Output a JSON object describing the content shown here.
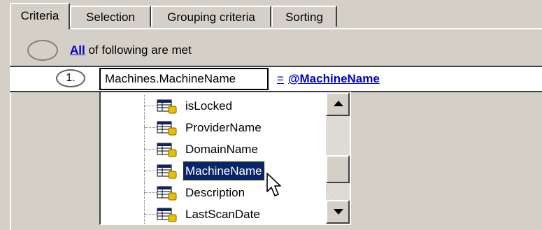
{
  "tabs": [
    {
      "label": "Criteria",
      "active": true
    },
    {
      "label": "Selection",
      "active": false
    },
    {
      "label": "Grouping criteria",
      "active": false
    },
    {
      "label": "Sorting",
      "active": false
    }
  ],
  "group_condition": {
    "quantifier": "All",
    "text": " of following are met"
  },
  "condition": {
    "number": "1.",
    "field": "Machines.MachineName",
    "operator": "=",
    "value": "@MachineName"
  },
  "field_list": {
    "items": [
      {
        "label": "isLocked",
        "icon": "table-field-icon",
        "selected": false
      },
      {
        "label": "ProviderName",
        "icon": "table-field-icon",
        "selected": false
      },
      {
        "label": "DomainName",
        "icon": "table-field-icon",
        "selected": false
      },
      {
        "label": "MachineName",
        "icon": "table-field-icon",
        "selected": true
      },
      {
        "label": "Description",
        "icon": "table-field-icon",
        "selected": false
      },
      {
        "label": "LastScanDate",
        "icon": "table-field-icon",
        "selected": false
      }
    ]
  },
  "colors": {
    "window_bg": "#d4d0c8",
    "link": "#0000cc",
    "selection_bg": "#0a246a",
    "selection_fg": "#ffffff"
  }
}
